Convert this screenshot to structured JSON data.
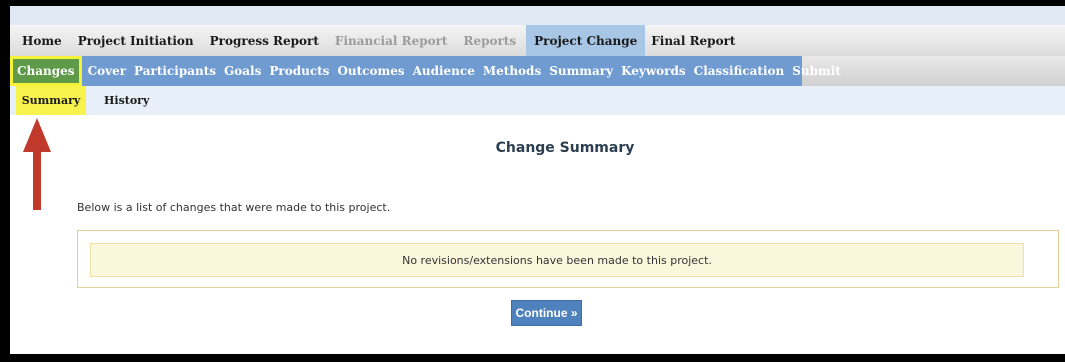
{
  "nav_primary": [
    {
      "label": "Home",
      "state": "normal"
    },
    {
      "label": "Project Initiation",
      "state": "normal"
    },
    {
      "label": "Progress Report",
      "state": "normal"
    },
    {
      "label": "Financial Report",
      "state": "disabled"
    },
    {
      "label": "Reports",
      "state": "disabled"
    },
    {
      "label": "Project Change",
      "state": "active"
    },
    {
      "label": "Final Report",
      "state": "normal"
    }
  ],
  "nav_secondary": [
    {
      "label": "Changes",
      "state": "active"
    },
    {
      "label": "Cover"
    },
    {
      "label": "Participants"
    },
    {
      "label": "Goals"
    },
    {
      "label": "Products"
    },
    {
      "label": "Outcomes"
    },
    {
      "label": "Audience"
    },
    {
      "label": "Methods"
    },
    {
      "label": "Summary"
    },
    {
      "label": "Keywords"
    },
    {
      "label": "Classification"
    },
    {
      "label": "Submit"
    }
  ],
  "nav_tertiary": [
    {
      "label": "Summary",
      "state": "active"
    },
    {
      "label": "History"
    }
  ],
  "main": {
    "title": "Change Summary",
    "intro": "Below is a list of changes that were made to this project.",
    "notice": "No revisions/extensions have been made to this project.",
    "continue_label": "Continue »"
  },
  "annotation": {
    "arrow_icon": "red-up-arrow",
    "arrow_color": "#c0392b",
    "highlight_color": "#f5f23a"
  },
  "colors": {
    "nav_active_blue": "#a8c6e6",
    "subnav_blue": "#6f9bd1",
    "changes_green": "#5e9a48",
    "button_blue": "#4f81bd"
  }
}
